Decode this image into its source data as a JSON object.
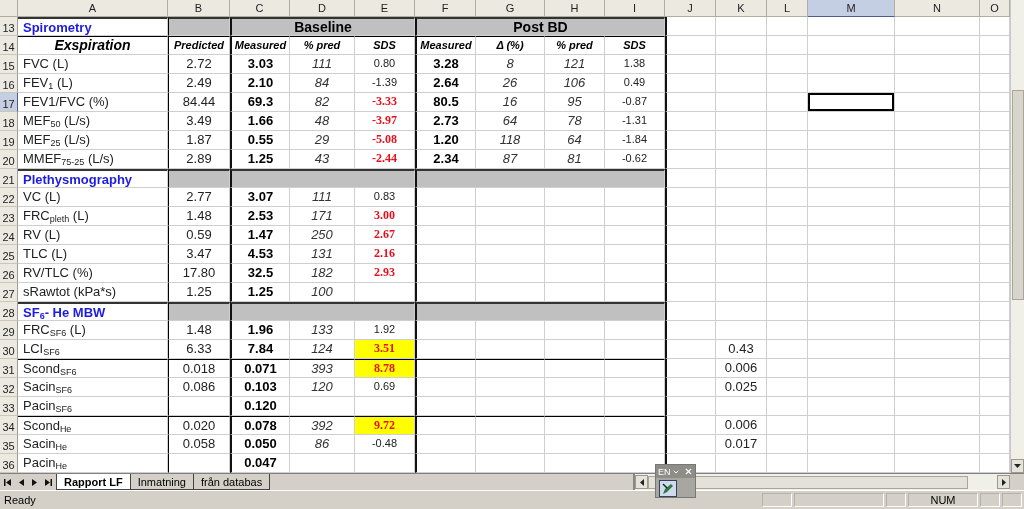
{
  "columns": [
    {
      "label": "A",
      "selected": false
    },
    {
      "label": "B",
      "selected": false
    },
    {
      "label": "C",
      "selected": false
    },
    {
      "label": "D",
      "selected": false
    },
    {
      "label": "E",
      "selected": false
    },
    {
      "label": "F",
      "selected": false
    },
    {
      "label": "G",
      "selected": false
    },
    {
      "label": "H",
      "selected": false
    },
    {
      "label": "I",
      "selected": false
    },
    {
      "label": "J",
      "selected": false
    },
    {
      "label": "K",
      "selected": false
    },
    {
      "label": "L",
      "selected": false
    },
    {
      "label": "M",
      "selected": true
    },
    {
      "label": "N",
      "selected": false
    },
    {
      "label": "O",
      "selected": false
    }
  ],
  "sections": [
    {
      "number": "13",
      "selected": false,
      "title": "Spirometry",
      "baseline": "Baseline",
      "post": "Post BD",
      "header": {
        "number": "14",
        "selected": false,
        "label": "Exspiration",
        "columns": [
          "Predicted",
          "Measured",
          "% pred",
          "SDS",
          "Measured",
          "Δ (%)",
          "% pred",
          "SDS"
        ]
      },
      "groups": [
        [
          {
            "number": "15",
            "selected": false,
            "label": "FVC (L)",
            "predicted": "2.72",
            "measured": "3.03",
            "pct_pred": "111",
            "sds": {
              "text": "0.80",
              "alert": false,
              "highlight": false
            },
            "post_measured": "3.28",
            "delta": "8",
            "post_pct_pred": "121",
            "post_sds": "1.38"
          },
          {
            "number": "16",
            "selected": false,
            "label": "FEV$_{1}$ (L)",
            "predicted": "2.49",
            "measured": "2.10",
            "pct_pred": "84",
            "sds": {
              "text": "-1.39",
              "alert": false,
              "highlight": false
            },
            "post_measured": "2.64",
            "delta": "26",
            "post_pct_pred": "106",
            "post_sds": "0.49"
          },
          {
            "number": "17",
            "selected": true,
            "label": "FEV1/FVC (%)",
            "predicted": "84.44",
            "measured": "69.3",
            "pct_pred": "82",
            "sds": {
              "text": "-3.33",
              "alert": true,
              "highlight": false
            },
            "post_measured": "80.5",
            "delta": "16",
            "post_pct_pred": "95",
            "post_sds": "-0.87"
          },
          {
            "number": "18",
            "selected": false,
            "label": "MEF$_{50}$ (L/s)",
            "predicted": "3.49",
            "measured": "1.66",
            "pct_pred": "48",
            "sds": {
              "text": "-3.97",
              "alert": true,
              "highlight": false
            },
            "post_measured": "2.73",
            "delta": "64",
            "post_pct_pred": "78",
            "post_sds": "-1.31"
          },
          {
            "number": "19",
            "selected": false,
            "label": "MEF$_{25}$ (L/s)",
            "predicted": "1.87",
            "measured": "0.55",
            "pct_pred": "29",
            "sds": {
              "text": "-5.08",
              "alert": true,
              "highlight": false
            },
            "post_measured": "1.20",
            "delta": "118",
            "post_pct_pred": "64",
            "post_sds": "-1.84"
          },
          {
            "number": "20",
            "selected": false,
            "label": "MMEF$_{75-25}$ (L/s)",
            "predicted": "2.89",
            "measured": "1.25",
            "pct_pred": "43",
            "sds": {
              "text": "-2.44",
              "alert": true,
              "highlight": false
            },
            "post_measured": "2.34",
            "delta": "87",
            "post_pct_pred": "81",
            "post_sds": "-0.62"
          }
        ]
      ]
    },
    {
      "number": "21",
      "selected": false,
      "title": "Plethysmography",
      "groups": [
        [
          {
            "number": "22",
            "selected": false,
            "label": "VC (L)",
            "predicted": "2.77",
            "measured": "3.07",
            "pct_pred": "111",
            "sds": {
              "text": "0.83",
              "alert": false,
              "highlight": false
            }
          },
          {
            "number": "23",
            "selected": false,
            "label": "FRC$_{pleth}$ (L)",
            "predicted": "1.48",
            "measured": "2.53",
            "pct_pred": "171",
            "sds": {
              "text": "3.00",
              "alert": true,
              "highlight": false
            }
          },
          {
            "number": "24",
            "selected": false,
            "label": "RV (L)",
            "predicted": "0.59",
            "measured": "1.47",
            "pct_pred": "250",
            "sds": {
              "text": "2.67",
              "alert": true,
              "highlight": false
            }
          },
          {
            "number": "25",
            "selected": false,
            "label": "TLC (L)",
            "predicted": "3.47",
            "measured": "4.53",
            "pct_pred": "131",
            "sds": {
              "text": "2.16",
              "alert": true,
              "highlight": false
            }
          },
          {
            "number": "26",
            "selected": false,
            "label": "RV/TLC (%)",
            "predicted": "17.80",
            "measured": "32.5",
            "pct_pred": "182",
            "sds": {
              "text": "2.93",
              "alert": true,
              "highlight": false
            }
          },
          {
            "number": "27",
            "selected": false,
            "label": "sRawtot (kPa*s)",
            "predicted": "1.25",
            "measured": "1.25",
            "pct_pred": "100"
          }
        ]
      ]
    },
    {
      "number": "28",
      "selected": false,
      "title": "SF$_{6}$- He MBW",
      "groups": [
        [
          {
            "number": "29",
            "selected": false,
            "label": "FRC$_{SF6}$ (L)",
            "predicted": "1.48",
            "measured": "1.96",
            "pct_pred": "133",
            "sds": {
              "text": "1.92",
              "alert": false,
              "highlight": false
            }
          },
          {
            "number": "30",
            "selected": false,
            "label": "LCI$_{SF6}$",
            "predicted": "6.33",
            "measured": "7.84",
            "pct_pred": "124",
            "sds": {
              "text": "3.51",
              "alert": true,
              "highlight": true
            },
            "column_k": "0.43"
          }
        ],
        [
          {
            "number": "31",
            "selected": false,
            "label": "Scond$_{SF6}$",
            "predicted": "0.018",
            "measured": "0.071",
            "pct_pred": "393",
            "sds": {
              "text": "8.78",
              "alert": true,
              "highlight": true
            },
            "column_k": "0.006"
          },
          {
            "number": "32",
            "selected": false,
            "label": "Sacin$_{SF6}$",
            "predicted": "0.086",
            "measured": "0.103",
            "pct_pred": "120",
            "sds": {
              "text": "0.69",
              "alert": false,
              "highlight": false
            },
            "column_k": "0.025"
          },
          {
            "number": "33",
            "selected": false,
            "label": "Pacin$_{SF6}$",
            "measured": "0.120"
          }
        ],
        [
          {
            "number": "34",
            "selected": false,
            "label": "Scond$_{He}$",
            "predicted": "0.020",
            "measured": "0.078",
            "pct_pred": "392",
            "sds": {
              "text": "9.72",
              "alert": true,
              "highlight": true
            },
            "column_k": "0.006"
          },
          {
            "number": "35",
            "selected": false,
            "label": "Sacin$_{He}$",
            "predicted": "0.058",
            "measured": "0.050",
            "pct_pred": "86",
            "sds": {
              "text": "-0.48",
              "alert": false,
              "highlight": false
            },
            "column_k": "0.017"
          },
          {
            "number": "36",
            "selected": false,
            "label": "Pacin$_{He}$",
            "measured": "0.047"
          }
        ]
      ]
    }
  ],
  "sheet_tabs": [
    {
      "label": "Rapport LF",
      "selected": true
    },
    {
      "label": "Inmatning",
      "selected": false
    },
    {
      "label": "från databas",
      "selected": false
    }
  ],
  "language_bar": {
    "label": "EN"
  },
  "status_bar": {
    "status": "Ready",
    "indicator": "NUM"
  }
}
